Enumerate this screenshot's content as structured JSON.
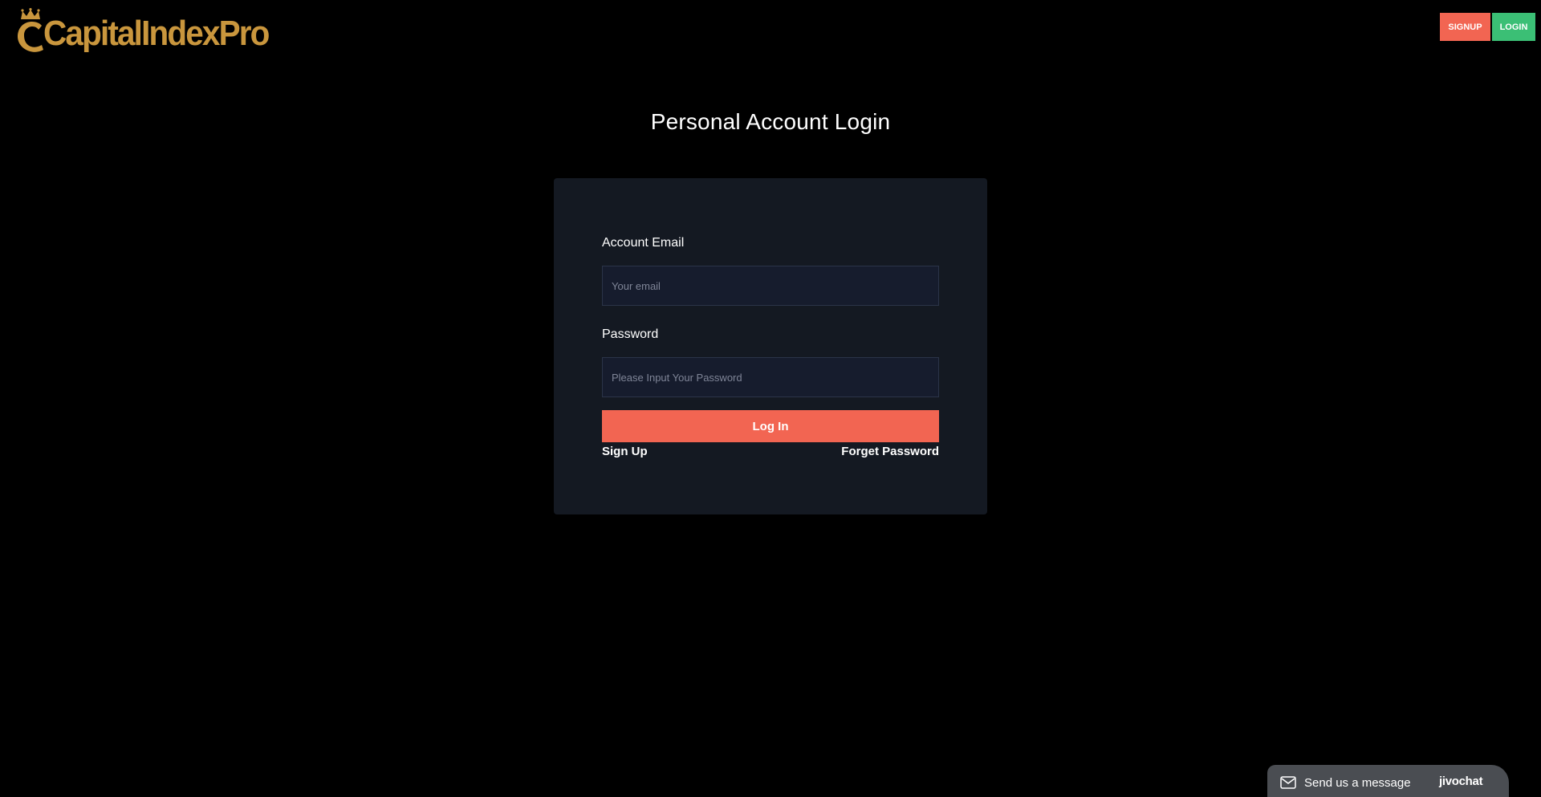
{
  "header": {
    "logo_text": "CapitalIndexPro",
    "signup_label": "SIGNUP",
    "login_label": "LOGIN"
  },
  "main": {
    "title": "Personal Account Login",
    "email_label": "Account Email",
    "email_placeholder": "Your email",
    "password_label": "Password",
    "password_placeholder": "Please Input Your Password",
    "login_button": "Log In",
    "signup_link": "Sign Up",
    "forgot_link": "Forget Password"
  },
  "chat": {
    "message": "Send us a message",
    "brand": "jivochat"
  },
  "colors": {
    "background": "#000000",
    "card": "#141922",
    "accent_red": "#f26552",
    "accent_green": "#3bbf75",
    "logo_gold": "#c9963d",
    "input_bg": "#161c2d"
  },
  "icons": {
    "logo": "crown-icon",
    "chat": "envelope-icon"
  }
}
